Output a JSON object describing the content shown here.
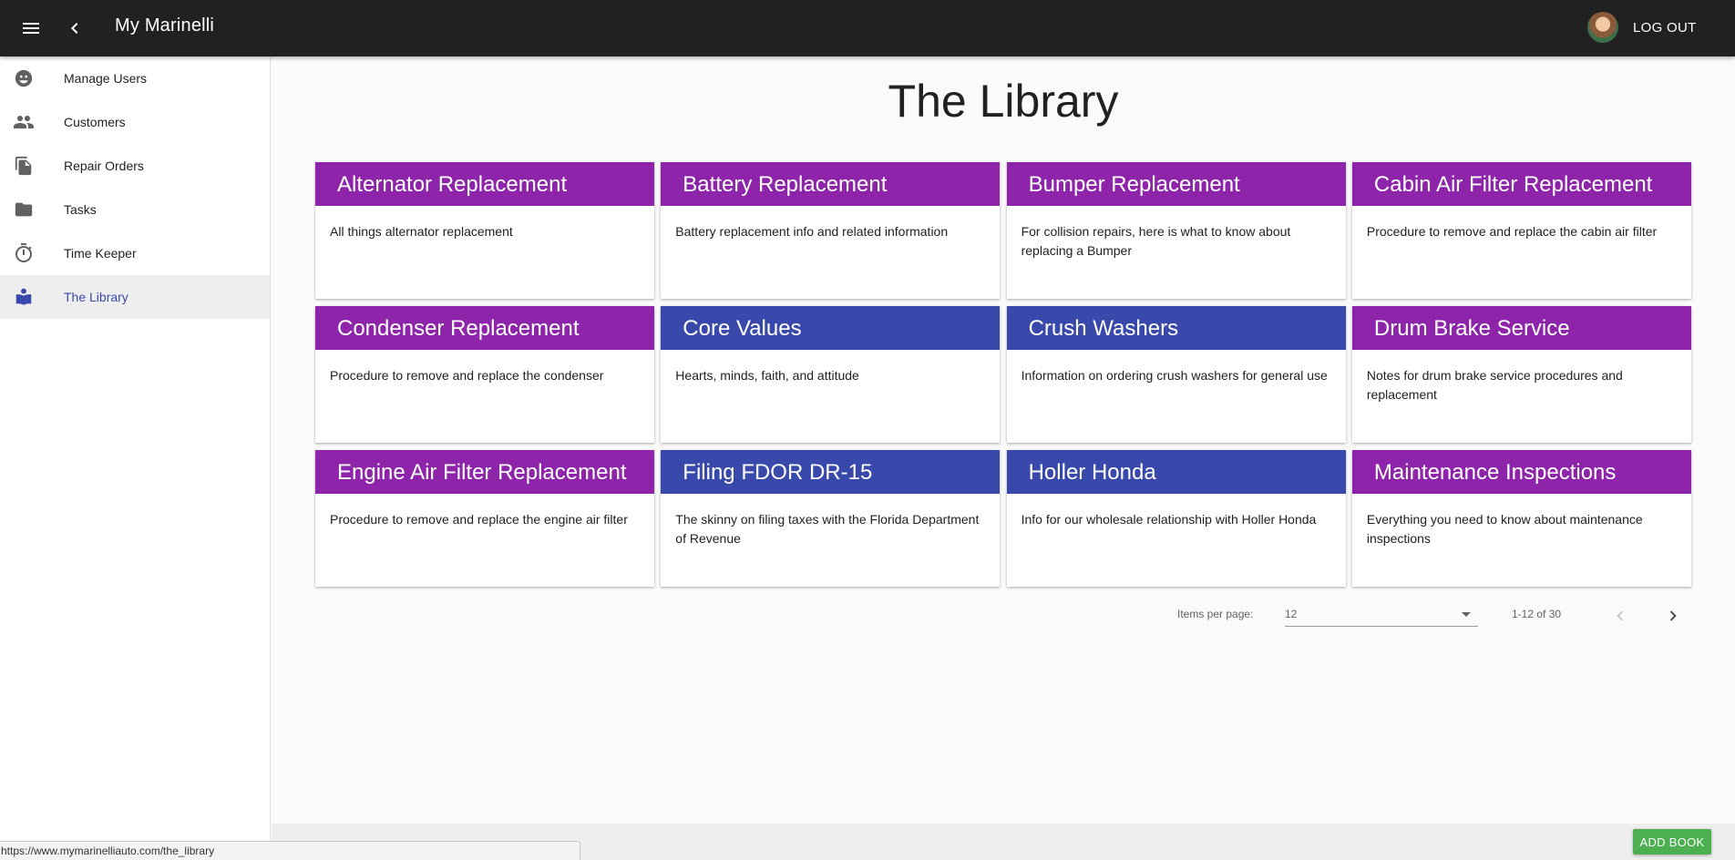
{
  "header": {
    "title": "My Marinelli",
    "logout_label": "LOG OUT"
  },
  "sidebar": {
    "items": [
      {
        "label": "Manage Users",
        "icon": "face-icon",
        "active": false
      },
      {
        "label": "Customers",
        "icon": "people-icon",
        "active": false
      },
      {
        "label": "Repair Orders",
        "icon": "file-copy-icon",
        "active": false
      },
      {
        "label": "Tasks",
        "icon": "label-icon",
        "active": false
      },
      {
        "label": "Time Keeper",
        "icon": "timer-icon",
        "active": false
      },
      {
        "label": "The Library",
        "icon": "book-reader-icon",
        "active": true
      }
    ]
  },
  "main": {
    "title": "The Library",
    "cards": [
      {
        "title": "Alternator Replacement",
        "description": "All things alternator replacement",
        "color": "#8e24aa"
      },
      {
        "title": "Battery Replacement",
        "description": "Battery replacement info and related information",
        "color": "#8e24aa"
      },
      {
        "title": "Bumper Replacement",
        "description": "For collision repairs, here is what to know about replacing a Bumper",
        "color": "#8e24aa"
      },
      {
        "title": "Cabin Air Filter Replacement",
        "description": "Procedure to remove and replace the cabin air filter",
        "color": "#8e24aa"
      },
      {
        "title": "Condenser Replacement",
        "description": "Procedure to remove and replace the condenser",
        "color": "#8e24aa"
      },
      {
        "title": "Core Values",
        "description": "Hearts, minds, faith, and attitude",
        "color": "#3949ab"
      },
      {
        "title": "Crush Washers",
        "description": "Information on ordering crush washers for general use",
        "color": "#3949ab"
      },
      {
        "title": "Drum Brake Service",
        "description": "Notes for drum brake service procedures and replacement",
        "color": "#8e24aa"
      },
      {
        "title": "Engine Air Filter Replacement",
        "description": "Procedure to remove and replace the engine air filter",
        "color": "#8e24aa"
      },
      {
        "title": "Filing FDOR DR-15",
        "description": "The skinny on filing taxes with the Florida Department of Revenue",
        "color": "#3949ab"
      },
      {
        "title": "Holler Honda",
        "description": "Info for our wholesale relationship with Holler Honda",
        "color": "#3949ab"
      },
      {
        "title": "Maintenance Inspections",
        "description": "Everything you need to know about maintenance inspections",
        "color": "#8e24aa"
      }
    ]
  },
  "paginator": {
    "items_per_page_label": "Items per page:",
    "items_per_page_value": "12",
    "range_label": "1-12 of 30"
  },
  "actions": {
    "add_book_label": "ADD BOOK"
  },
  "status_bar": {
    "url": "https://www.mymarinelliauto.com/the_library"
  }
}
